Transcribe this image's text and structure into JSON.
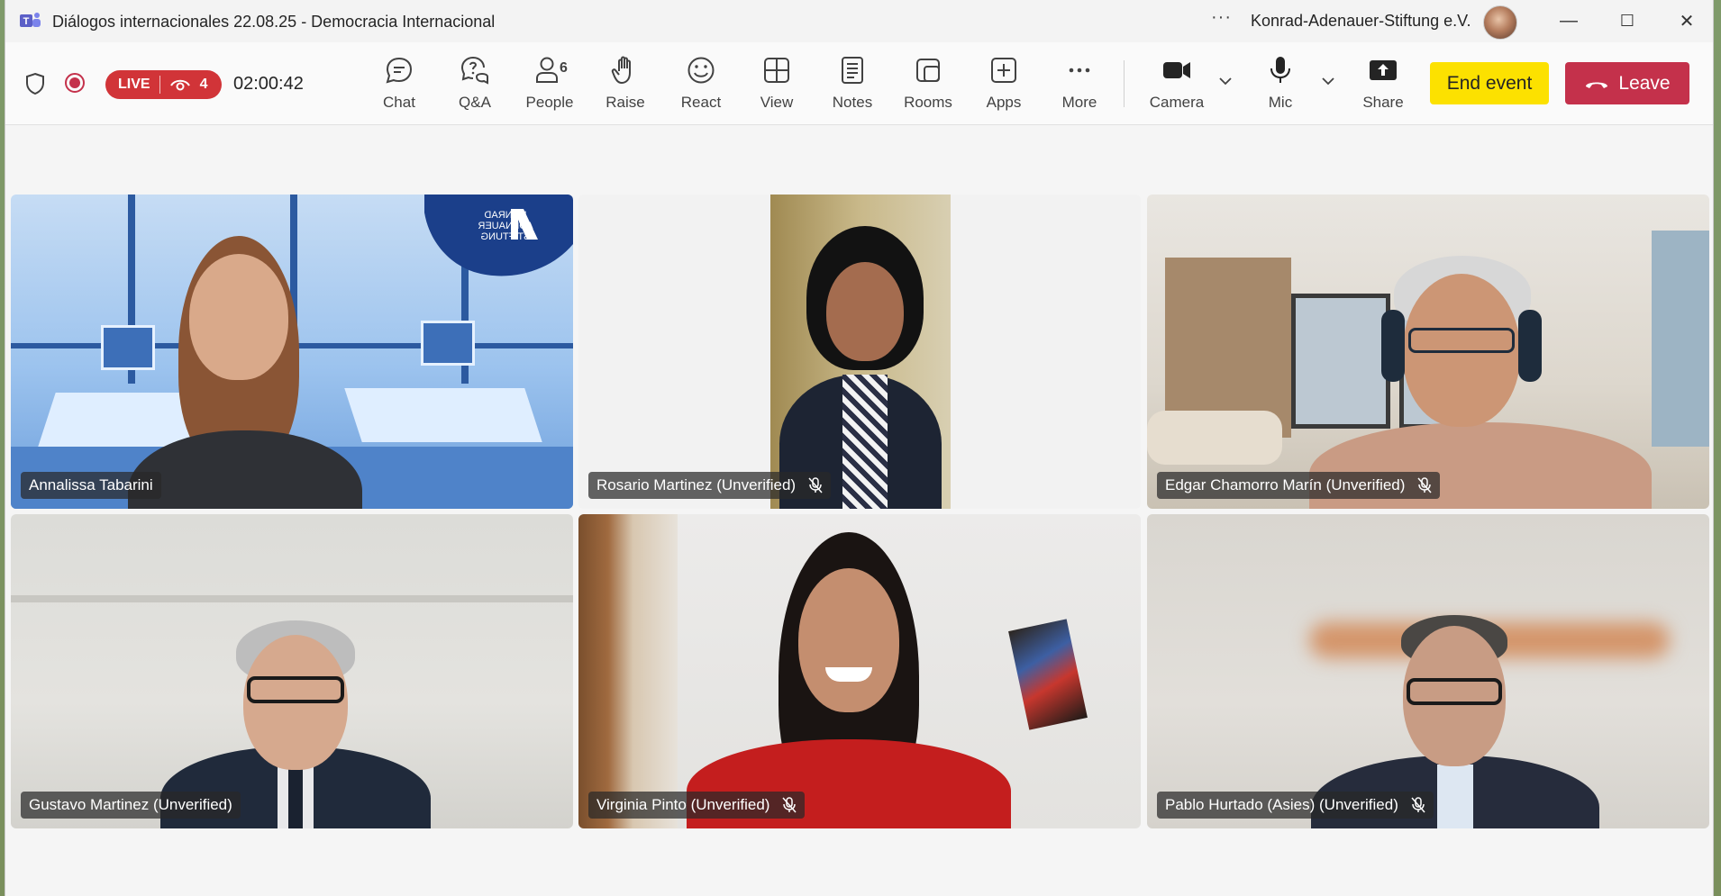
{
  "window": {
    "title": "Diálogos internacionales 22.08.25 - Democracia Internacional",
    "more_glyph": "···",
    "org_name": "Konrad-Adenauer-Stiftung e.V.",
    "controls": {
      "minimize": "—",
      "maximize": "☐",
      "close": "✕"
    }
  },
  "status": {
    "live_label": "LIVE",
    "viewer_count": "4",
    "elapsed": "02:00:42"
  },
  "toolbar": {
    "chat": "Chat",
    "qa": "Q&A",
    "people": "People",
    "people_count": "6",
    "raise": "Raise",
    "react": "React",
    "view": "View",
    "notes": "Notes",
    "rooms": "Rooms",
    "apps": "Apps",
    "more": "More",
    "camera": "Camera",
    "mic": "Mic",
    "share": "Share",
    "end_event": "End event",
    "leave": "Leave"
  },
  "participants": [
    {
      "name": "Annalissa Tabarini",
      "muted": false,
      "background_logo": [
        "KONRAD",
        "ADENAUER",
        "STIFTUNG"
      ]
    },
    {
      "name": "Rosario Martinez (Unverified)",
      "muted": true
    },
    {
      "name": "Edgar Chamorro Marín (Unverified)",
      "muted": true
    },
    {
      "name": "Gustavo Martinez (Unverified)",
      "muted": false
    },
    {
      "name": "Virginia Pinto (Unverified)",
      "muted": true
    },
    {
      "name": "Pablo Hurtado (Asies) (Unverified)",
      "muted": true
    }
  ],
  "colors": {
    "live_red": "#d13438",
    "leave_red": "#c4314b",
    "end_yellow": "#fce100",
    "teams_purple": "#5b5fc7",
    "kas_blue": "#1b3f8a"
  }
}
